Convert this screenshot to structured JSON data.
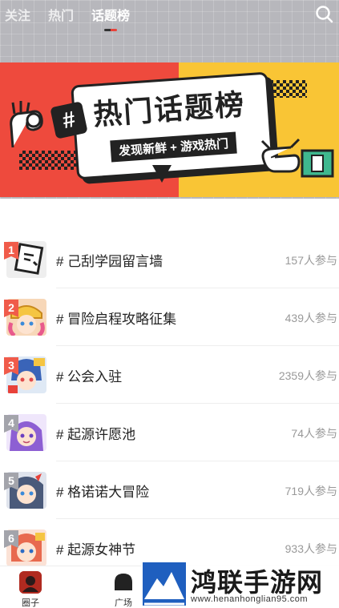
{
  "header": {
    "tabs": [
      {
        "label": "关注",
        "active": false
      },
      {
        "label": "热门",
        "active": false
      },
      {
        "label": "话题榜",
        "active": true
      }
    ],
    "search_icon": "search-icon"
  },
  "banner": {
    "title": "热门话题榜",
    "hash": "#",
    "subtitle": "发现新鲜 + 游戏热门",
    "colors": {
      "left": "#ee4a3d",
      "right": "#f9c535"
    }
  },
  "topics": [
    {
      "rank": "1",
      "hot": true,
      "title": "# 己刮学园留言墙",
      "count": "157人参与",
      "thumb_color": "#e9e9e9"
    },
    {
      "rank": "2",
      "hot": true,
      "title": "# 冒险启程攻略征集",
      "count": "439人参与",
      "thumb_color": "#f5c542"
    },
    {
      "rank": "3",
      "hot": true,
      "title": "# 公会入驻",
      "count": "2359人参与",
      "thumb_color": "#5b9be0"
    },
    {
      "rank": "4",
      "hot": false,
      "title": "# 起源许愿池",
      "count": "74人参与",
      "thumb_color": "#8d5fd3"
    },
    {
      "rank": "5",
      "hot": false,
      "title": "# 格诺诺大冒险",
      "count": "719人参与",
      "thumb_color": "#4a5a7a"
    },
    {
      "rank": "6",
      "hot": false,
      "title": "# 起源女神节",
      "count": "933人参与",
      "thumb_color": "#e86a4f"
    }
  ],
  "bottom_nav": [
    {
      "label": "圈子",
      "icon": "circle-icon"
    },
    {
      "label": "广场",
      "icon": "square-icon"
    }
  ],
  "watermark": {
    "text": "鸿联手游网",
    "url": "www.henanhonglian95.com"
  }
}
